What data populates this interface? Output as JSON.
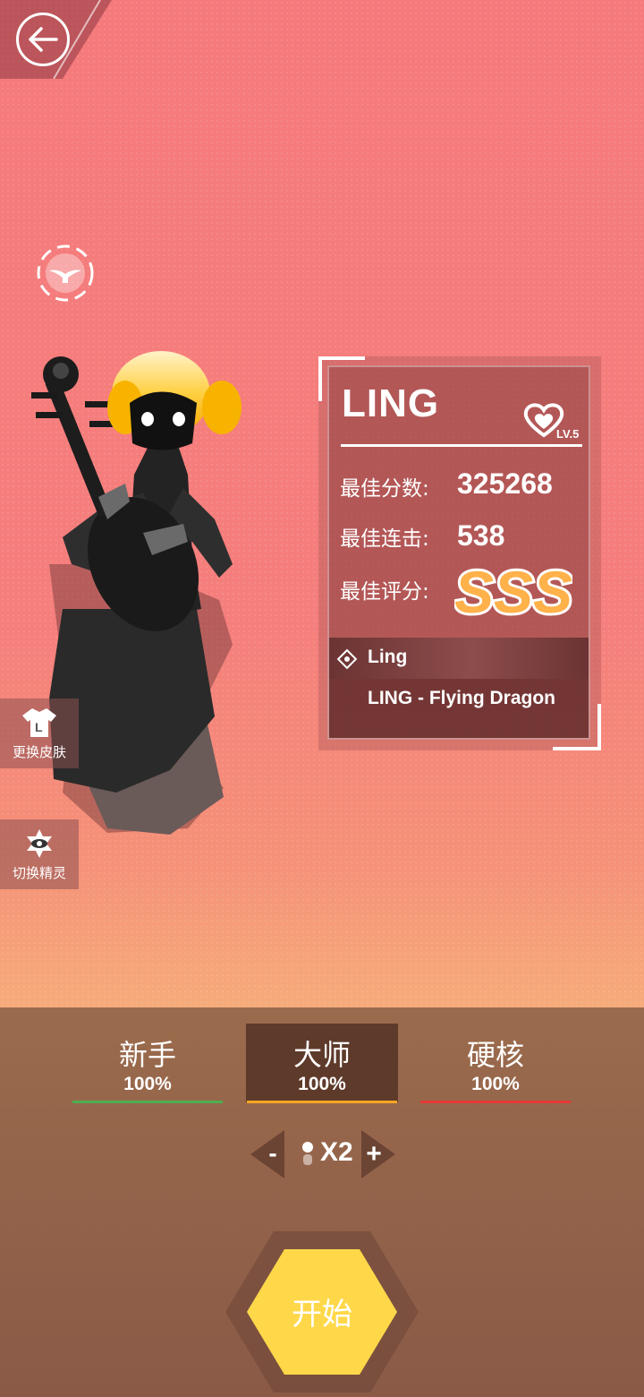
{
  "nav": {
    "back_icon": "back-arrow-icon",
    "fly_icon": "bird-icon"
  },
  "side_buttons": [
    {
      "label": "更换皮肤",
      "icon": "shirt-icon"
    },
    {
      "label": "切换精灵",
      "icon": "eye-icon"
    }
  ],
  "card": {
    "character": "LING",
    "level": "LV.5",
    "best_score_label": "最佳分数:",
    "best_score": "325268",
    "best_combo_label": "最佳连击:",
    "best_combo": "538",
    "best_grade_label": "最佳评分:",
    "best_grade": "SSS",
    "composer": "Ling",
    "song": "LING - Flying Dragon"
  },
  "difficulties": [
    {
      "name": "新手",
      "pct": "100%",
      "color": "#4caf50",
      "selected": false
    },
    {
      "name": "大师",
      "pct": "100%",
      "color": "#f5a623",
      "selected": true
    },
    {
      "name": "硬核",
      "pct": "100%",
      "color": "#e53935",
      "selected": false
    }
  ],
  "speed": {
    "minus": "-",
    "plus": "+",
    "value": "X2"
  },
  "start_label": "开始",
  "colors": {
    "bg_top": "#f57a7c",
    "bg_bottom": "#f6ab7b",
    "panel": "#8f5f49",
    "start": "#ffd84a"
  }
}
